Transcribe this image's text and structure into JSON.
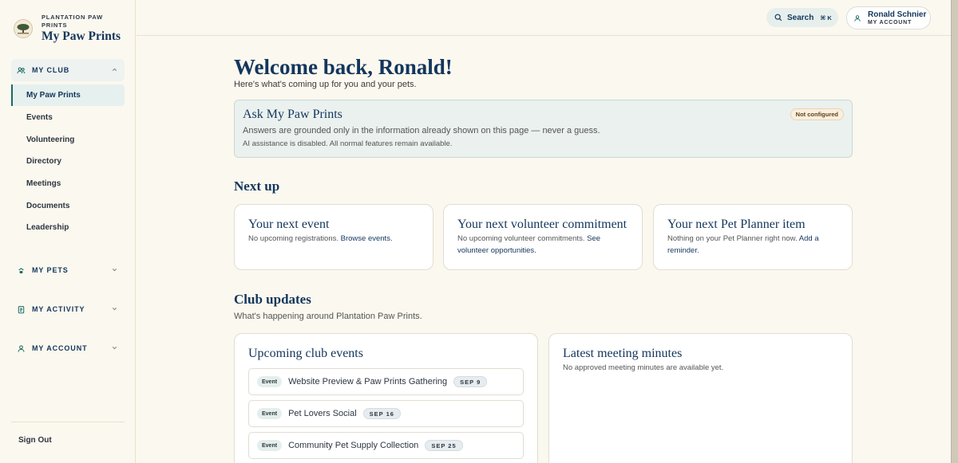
{
  "brand": {
    "org": "PLANTATION PAW PRINTS",
    "app": "My Paw Prints"
  },
  "sidebar": {
    "groups": [
      {
        "label": "MY CLUB",
        "icon": "people-icon",
        "expanded": true
      },
      {
        "label": "MY PETS",
        "icon": "paw-icon",
        "expanded": false
      },
      {
        "label": "MY ACTIVITY",
        "icon": "clipboard-icon",
        "expanded": false
      },
      {
        "label": "MY ACCOUNT",
        "icon": "user-icon",
        "expanded": false
      }
    ],
    "club_items": [
      {
        "label": "My Paw Prints",
        "active": true
      },
      {
        "label": "Events"
      },
      {
        "label": "Volunteering"
      },
      {
        "label": "Directory"
      },
      {
        "label": "Meetings"
      },
      {
        "label": "Documents"
      },
      {
        "label": "Leadership"
      }
    ],
    "sign_out": "Sign Out"
  },
  "topbar": {
    "search_label": "Search",
    "search_shortcut": "⌘ K",
    "account_name": "Ronald Schnier",
    "account_sub": "MY ACCOUNT"
  },
  "main": {
    "welcome": "Welcome back, Ronald!",
    "welcome_sub": "Here's what's coming up for you and your pets.",
    "ask": {
      "title": "Ask My Paw Prints",
      "line1": "Answers are grounded only in the information already shown on this page — never a guess.",
      "line2": "AI assistance is disabled. All normal features remain available.",
      "badge": "Not configured"
    },
    "next_up": {
      "heading": "Next up",
      "cards": [
        {
          "title": "Your next event",
          "text": "No upcoming registrations.",
          "link": "Browse events."
        },
        {
          "title": "Your next volunteer commitment",
          "text": "No upcoming volunteer commitments.",
          "link": "See volunteer opportunities."
        },
        {
          "title": "Your next Pet Planner item",
          "text": "Nothing on your Pet Planner right now.",
          "link": "Add a reminder."
        }
      ]
    },
    "club_updates": {
      "heading": "Club updates",
      "sub": "What's happening around Plantation Paw Prints.",
      "events_card": {
        "title": "Upcoming club events",
        "events": [
          {
            "tag": "Event",
            "title": "Website Preview & Paw Prints Gathering",
            "date": "SEP 9"
          },
          {
            "tag": "Event",
            "title": "Pet Lovers Social",
            "date": "SEP 16"
          },
          {
            "tag": "Event",
            "title": "Community Pet Supply Collection",
            "date": "SEP 25"
          }
        ]
      },
      "minutes_card": {
        "title": "Latest meeting minutes",
        "text": "No approved meeting minutes are available yet."
      }
    }
  }
}
